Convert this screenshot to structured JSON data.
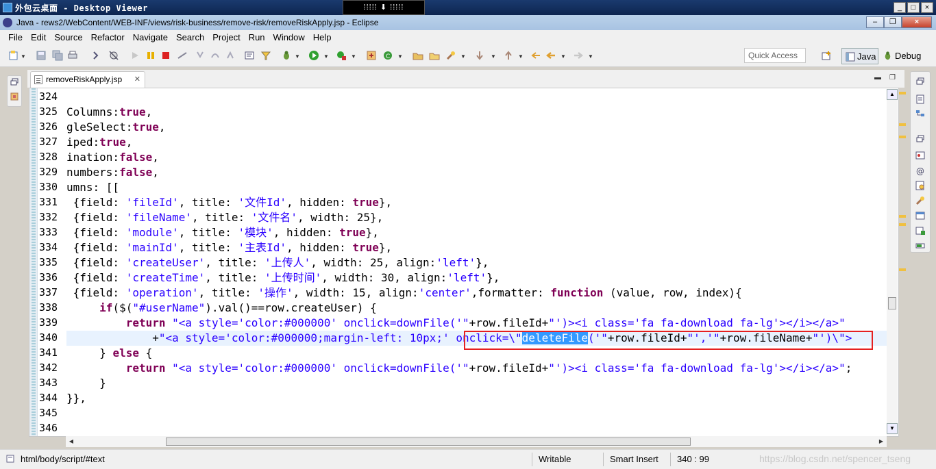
{
  "viewer": {
    "title": "外包云桌面 - Desktop Viewer",
    "center_label": "⁞⁞⁞⁞⁞  ⬇  ⁞⁞⁞⁞⁞"
  },
  "window": {
    "title": "Java - rews2/WebContent/WEB-INF/views/risk-business/remove-risk/removeRiskApply.jsp - Eclipse"
  },
  "menu": [
    "File",
    "Edit",
    "Source",
    "Refactor",
    "Navigate",
    "Search",
    "Project",
    "Run",
    "Window",
    "Help"
  ],
  "toolbar": {
    "quick_access_placeholder": "Quick Access",
    "perspectives": [
      "Java",
      "Debug"
    ]
  },
  "editor": {
    "tab_label": "removeRiskApply.jsp",
    "lines": [
      {
        "num": "324",
        "parts": []
      },
      {
        "num": "325",
        "parts": [
          [
            "t",
            "Columns:"
          ],
          [
            "kw",
            "true"
          ],
          [
            "t",
            ","
          ]
        ]
      },
      {
        "num": "326",
        "parts": [
          [
            "t",
            "gleSelect:"
          ],
          [
            "kw",
            "true"
          ],
          [
            "t",
            ","
          ]
        ]
      },
      {
        "num": "327",
        "parts": [
          [
            "t",
            "iped:"
          ],
          [
            "kw",
            "true"
          ],
          [
            "t",
            ","
          ]
        ]
      },
      {
        "num": "328",
        "parts": [
          [
            "t",
            "ination:"
          ],
          [
            "kw",
            "false"
          ],
          [
            "t",
            ","
          ]
        ]
      },
      {
        "num": "329",
        "parts": [
          [
            "t",
            "numbers:"
          ],
          [
            "kw",
            "false"
          ],
          [
            "t",
            ","
          ]
        ]
      },
      {
        "num": "330",
        "parts": [
          [
            "t",
            "umns: [["
          ]
        ]
      },
      {
        "num": "331",
        "parts": [
          [
            "t",
            " {field: "
          ],
          [
            "str",
            "'fileId'"
          ],
          [
            "t",
            ", title: "
          ],
          [
            "str",
            "'文件Id'"
          ],
          [
            "t",
            ", hidden: "
          ],
          [
            "kw",
            "true"
          ],
          [
            "t",
            "},"
          ]
        ]
      },
      {
        "num": "332",
        "parts": [
          [
            "t",
            " {field: "
          ],
          [
            "str",
            "'fileName'"
          ],
          [
            "t",
            ", title: "
          ],
          [
            "str",
            "'文件名'"
          ],
          [
            "t",
            ", width: 25},"
          ]
        ]
      },
      {
        "num": "333",
        "parts": [
          [
            "t",
            " {field: "
          ],
          [
            "str",
            "'module'"
          ],
          [
            "t",
            ", title: "
          ],
          [
            "str",
            "'模块'"
          ],
          [
            "t",
            ", hidden: "
          ],
          [
            "kw",
            "true"
          ],
          [
            "t",
            "},"
          ]
        ]
      },
      {
        "num": "334",
        "parts": [
          [
            "t",
            " {field: "
          ],
          [
            "str",
            "'mainId'"
          ],
          [
            "t",
            ", title: "
          ],
          [
            "str",
            "'主表Id'"
          ],
          [
            "t",
            ", hidden: "
          ],
          [
            "kw",
            "true"
          ],
          [
            "t",
            "},"
          ]
        ]
      },
      {
        "num": "335",
        "parts": [
          [
            "t",
            " {field: "
          ],
          [
            "str",
            "'createUser'"
          ],
          [
            "t",
            ", title: "
          ],
          [
            "str",
            "'上传人'"
          ],
          [
            "t",
            ", width: 25, align:"
          ],
          [
            "str",
            "'left'"
          ],
          [
            "t",
            "},"
          ]
        ]
      },
      {
        "num": "336",
        "parts": [
          [
            "t",
            " {field: "
          ],
          [
            "str",
            "'createTime'"
          ],
          [
            "t",
            ", title: "
          ],
          [
            "str",
            "'上传时间'"
          ],
          [
            "t",
            ", width: 30, align:"
          ],
          [
            "str",
            "'left'"
          ],
          [
            "t",
            "},"
          ]
        ]
      },
      {
        "num": "337",
        "parts": [
          [
            "t",
            " {field: "
          ],
          [
            "str",
            "'operation'"
          ],
          [
            "t",
            ", title: "
          ],
          [
            "str",
            "'操作'"
          ],
          [
            "t",
            ", width: 15, align:"
          ],
          [
            "str",
            "'center'"
          ],
          [
            "t",
            ",formatter: "
          ],
          [
            "kw",
            "function"
          ],
          [
            "t",
            " (value, row, index){"
          ]
        ]
      },
      {
        "num": "338",
        "parts": [
          [
            "t",
            "     "
          ],
          [
            "kw",
            "if"
          ],
          [
            "t",
            "($("
          ],
          [
            "str",
            "\"#userName\""
          ],
          [
            "t",
            ").val()==row.createUser) {"
          ]
        ]
      },
      {
        "num": "339",
        "parts": [
          [
            "t",
            "         "
          ],
          [
            "kw",
            "return"
          ],
          [
            "t",
            " "
          ],
          [
            "str",
            "\"<a style='color:#000000' onclick=downFile('\""
          ],
          [
            "t",
            "+row.fileId+"
          ],
          [
            "str",
            "\"')><i class='fa fa-download fa-lg'></i></a>\""
          ]
        ]
      },
      {
        "num": "340",
        "parts": [
          [
            "t",
            "             +"
          ],
          [
            "str",
            "\"<a style='color:#000000;margin-left: 10px;' onclick=\\\""
          ],
          [
            "sel",
            "deleteFile"
          ],
          [
            "str",
            "('\""
          ],
          [
            "t",
            "+row.fileId+"
          ],
          [
            "str",
            "\"','\""
          ],
          [
            "t",
            "+row.fileName+"
          ],
          [
            "str",
            "\"')\\\">"
          ]
        ]
      },
      {
        "num": "341",
        "parts": [
          [
            "t",
            "     } "
          ],
          [
            "kw",
            "else"
          ],
          [
            "t",
            " {"
          ]
        ]
      },
      {
        "num": "342",
        "parts": [
          [
            "t",
            "         "
          ],
          [
            "kw",
            "return"
          ],
          [
            "t",
            " "
          ],
          [
            "str",
            "\"<a style='color:#000000' onclick=downFile('\""
          ],
          [
            "t",
            "+row.fileId+"
          ],
          [
            "str",
            "\"')><i class='fa fa-download fa-lg'></i></a>\""
          ],
          [
            "t",
            ";"
          ]
        ]
      },
      {
        "num": "343",
        "parts": [
          [
            "t",
            "     }"
          ]
        ]
      },
      {
        "num": "344",
        "parts": [
          [
            "t",
            "}},"
          ]
        ]
      },
      {
        "num": "345",
        "parts": []
      },
      {
        "num": "346",
        "parts": []
      }
    ]
  },
  "status": {
    "path": "html/body/script/#text",
    "writable": "Writable",
    "insert_mode": "Smart Insert",
    "position": "340 : 99",
    "watermark": "https://blog.csdn.net/spencer_tseng"
  },
  "colors": {
    "keyword": "#7f0055",
    "string": "#2a00ff",
    "selection": "#3399ff",
    "current_line": "#e8f2fe",
    "highlight_box": "#e52020"
  }
}
